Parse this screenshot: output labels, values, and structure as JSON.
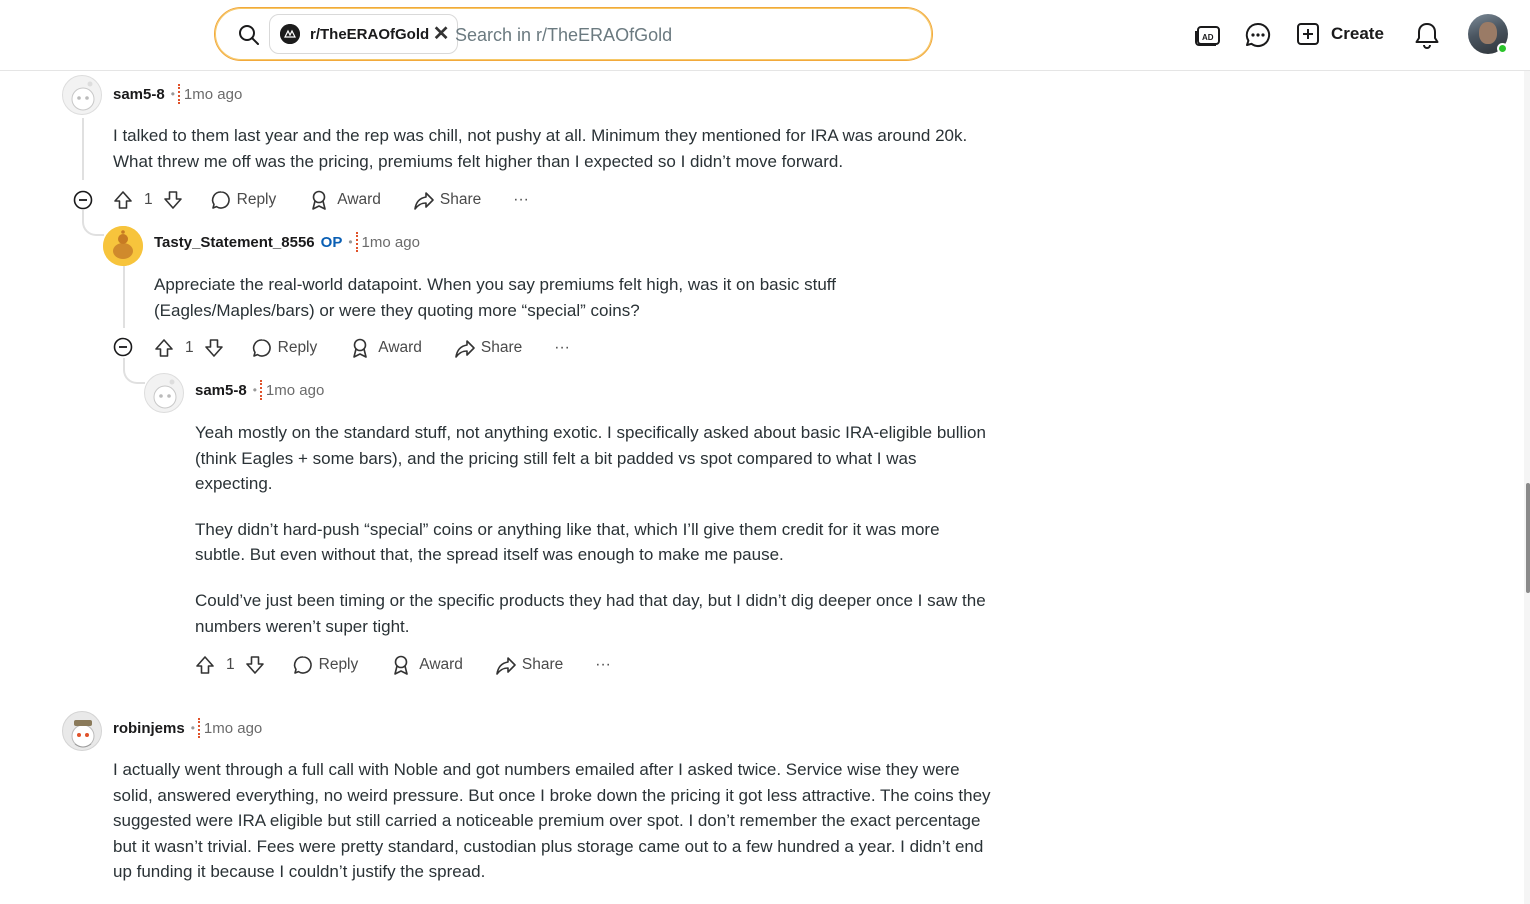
{
  "header": {
    "search_chip_label": "r/TheERAOfGold",
    "search_placeholder": "Search in r/TheERAOfGold",
    "create_label": "Create",
    "icons": [
      "search-icon",
      "advertise-icon",
      "chat-icon",
      "create-plus-icon",
      "bell-icon"
    ]
  },
  "colors": {
    "accent_search_border": "#f2a93b",
    "op_tag": "#0a5fb4",
    "online_dot": "#2bc42b",
    "thread_marker": "#e0522a"
  },
  "comments": [
    {
      "username": "sam5-8",
      "time": "1mo ago",
      "text": [
        "I talked to them last year and the rep was chill, not pushy at all. Minimum they mentioned for IRA was around 20k. What threw me off was the pricing, premiums felt higher than I expected so I didn’t move forward."
      ],
      "score": "1"
    },
    {
      "username": "Tasty_Statement_8556",
      "op_tag": "OP",
      "time": "1mo ago",
      "text": [
        "Appreciate the real-world datapoint. When you say premiums felt high, was it on basic stuff (Eagles/Maples/bars) or were they quoting more “special” coins?"
      ],
      "score": "1"
    },
    {
      "username": "sam5-8",
      "time": "1mo ago",
      "text": [
        "Yeah mostly on the standard stuff, not anything exotic. I specifically asked about basic IRA-eligible bullion (think Eagles + some bars), and the pricing still felt a bit padded vs spot compared to what I was expecting.",
        "They didn’t hard-push “special” coins or anything like that, which I’ll give them credit for it was more subtle. But even without that, the spread itself was enough to make me pause.",
        "Could’ve just been timing or the specific products they had that day, but I didn’t dig deeper once I saw the numbers weren’t super tight."
      ],
      "score": "1"
    },
    {
      "username": "robinjems",
      "time": "1mo ago",
      "text": [
        "I actually went through a full call with Noble and got numbers emailed after I asked twice. Service wise they were solid, answered everything, no weird pressure. But once I broke down the pricing it got less attractive. The coins they suggested were IRA eligible but still carried a noticeable premium over spot. I don’t remember the exact percentage but it wasn’t trivial. Fees were pretty standard, custodian plus storage came out to a few hundred a year. I didn’t end up funding it because I couldn’t justify the spread."
      ]
    }
  ],
  "actions": {
    "reply": "Reply",
    "award": "Award",
    "share": "Share",
    "more": "···"
  }
}
